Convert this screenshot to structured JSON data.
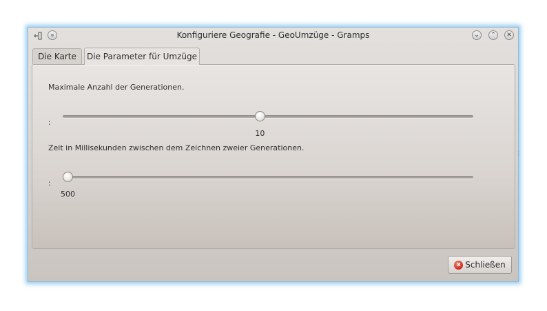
{
  "window": {
    "title": "Konfiguriere Geografie - GeoUmzüge - Gramps",
    "app_icon": "app-menu-icon",
    "sticky_icon": "sticky-icon",
    "buttons": {
      "minimize": "⌄",
      "maximize": "⌃",
      "close": "✕"
    }
  },
  "tabs": [
    {
      "label": "Die Karte",
      "active": false
    },
    {
      "label": "Die Parameter für Umzüge",
      "active": true
    }
  ],
  "settings": {
    "generations": {
      "label": "Maximale Anzahl der Generationen.",
      "prefix": ":",
      "value": "10",
      "fraction": 0.48
    },
    "delay": {
      "label": "Zeit in Millisekunden zwischen dem Zeichnen zweier Generationen.",
      "prefix": ":",
      "value": "500",
      "fraction": 0.0
    }
  },
  "footer": {
    "close_label": "Schließen",
    "close_icon": "x"
  },
  "colors": {
    "window_glow": "#7ebfe8",
    "close_icon": "#c9261a"
  }
}
